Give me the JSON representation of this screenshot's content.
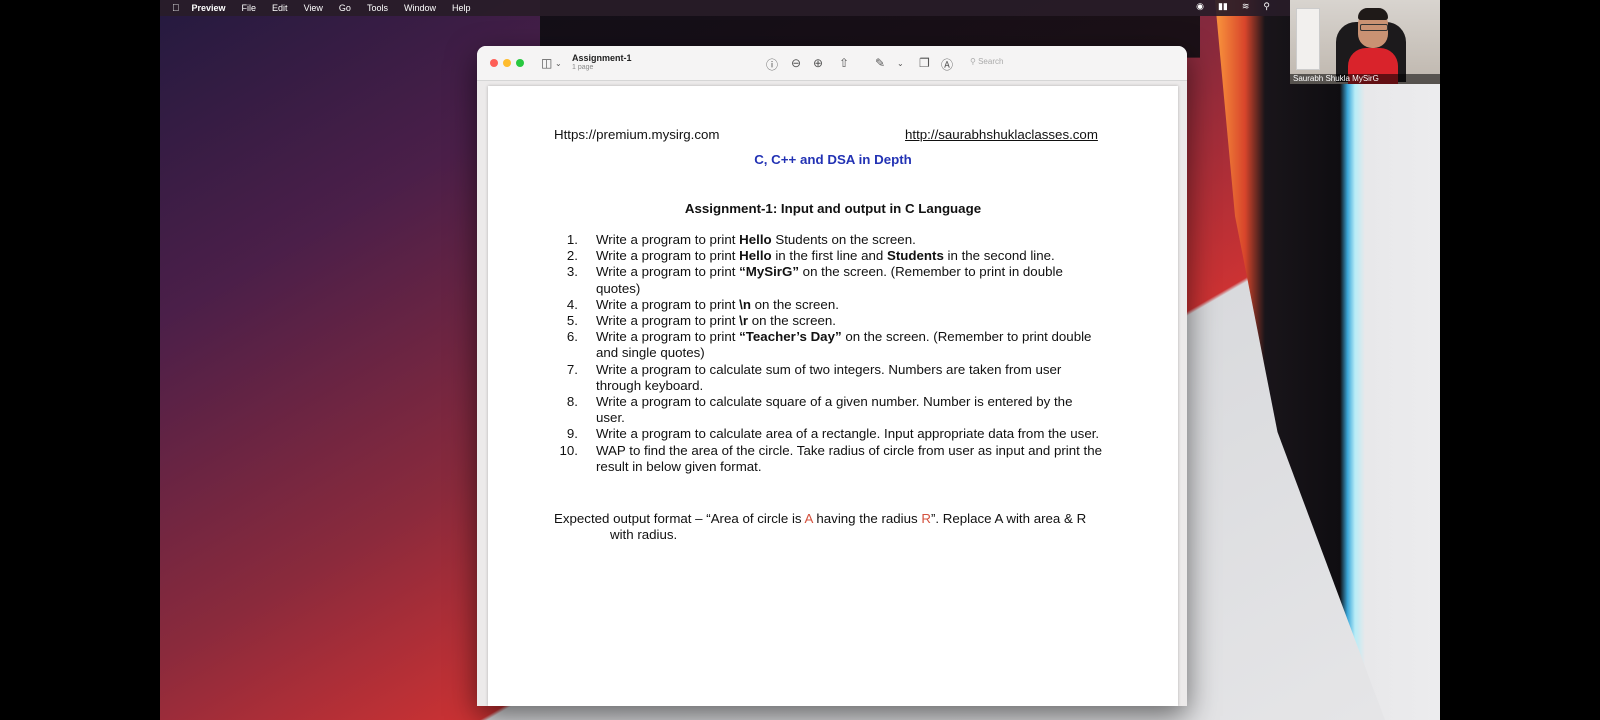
{
  "menubar": {
    "apple": "",
    "app_name": "Preview",
    "items": [
      "File",
      "Edit",
      "View",
      "Go",
      "Tools",
      "Window",
      "Help"
    ]
  },
  "webcam": {
    "caption": "Saurabh Shukla MySirG"
  },
  "window": {
    "title": "Assignment-1",
    "subtitle": "1 page",
    "search_placeholder": "Search"
  },
  "document": {
    "left_url": "Https://premium.mysirg.com",
    "right_url": "http://saurabhshuklaclasses.com",
    "course_title": "C, C++ and DSA in Depth",
    "assignment_title": "Assignment-1: Input and output in C Language",
    "questions": [
      {
        "num": "1.",
        "pre": "Write a program to print ",
        "b1": "Hello",
        "mid": " Students on the screen.",
        "b2": "",
        "post": ""
      },
      {
        "num": "2.",
        "pre": "Write a program to print ",
        "b1": "Hello",
        "mid": " in the first line and ",
        "b2": "Students",
        "post": " in the second line."
      },
      {
        "num": "3.",
        "pre": "Write a program to print ",
        "b1": "“MySirG”",
        "mid": " on the screen. (Remember to print in double quotes)",
        "b2": "",
        "post": ""
      },
      {
        "num": "4.",
        "pre": "Write a program to print ",
        "b1": "\\n",
        "mid": " on the screen.",
        "b2": "",
        "post": ""
      },
      {
        "num": "5.",
        "pre": "Write a program to print ",
        "b1": "\\r",
        "mid": " on the screen.",
        "b2": "",
        "post": ""
      },
      {
        "num": "6.",
        "pre": "Write a program to print ",
        "b1": "“Teacher’s Day”",
        "mid": " on the screen. (Remember to print double and single quotes)",
        "b2": "",
        "post": ""
      },
      {
        "num": "7.",
        "pre": "Write a program to calculate sum of two integers. Numbers are taken from user through keyboard.",
        "b1": "",
        "mid": "",
        "b2": "",
        "post": ""
      },
      {
        "num": "8.",
        "pre": "Write a program to calculate square of a given number. Number is entered by the user.",
        "b1": "",
        "mid": "",
        "b2": "",
        "post": ""
      },
      {
        "num": "9.",
        "pre": "Write a program to calculate area of a rectangle. Input appropriate data from the user.",
        "b1": "",
        "mid": "",
        "b2": "",
        "post": ""
      },
      {
        "num": "10.",
        "pre": "WAP to find the area of the circle. Take radius of circle from user as input and print the result in below given format.",
        "b1": "",
        "mid": "",
        "b2": "",
        "post": ""
      }
    ],
    "expected": {
      "part1": "Expected output format – “Area of circle is ",
      "a": "A",
      "part2": " having the radius ",
      "r": "R",
      "part3": "”. Replace A with area & R",
      "line2": "with radius."
    }
  }
}
